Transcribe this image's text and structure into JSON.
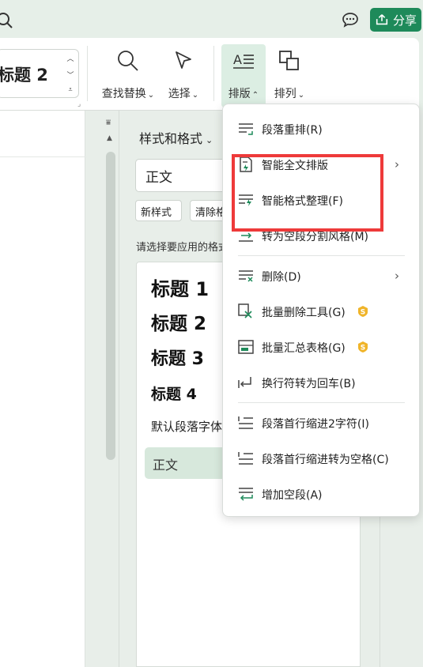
{
  "topbar": {
    "share_label": "分享"
  },
  "ribbon": {
    "style_box_text": "标题 2",
    "find_replace": "查找替换",
    "select": "选择",
    "layout": "排版",
    "arrange": "排列"
  },
  "pane": {
    "title": "样式和格式",
    "current_style": "正文",
    "new_style": "新样式",
    "clear_format": "清除格式",
    "hint": "请选择要应用的格式",
    "styles": [
      {
        "label": "标题 1"
      },
      {
        "label": "标题 2"
      },
      {
        "label": "标题 3"
      },
      {
        "label": "标题 4"
      }
    ],
    "default_para": "默认段落字体",
    "zhengwen": "正文"
  },
  "menu": {
    "items": [
      {
        "label": "段落重排(R)"
      },
      {
        "label": "智能全文排版"
      },
      {
        "label": "智能格式整理(F)"
      },
      {
        "label": "转为空段分割风格(M)"
      },
      {
        "label": "删除(D)"
      },
      {
        "label": "批量删除工具(G)"
      },
      {
        "label": "批量汇总表格(G)"
      },
      {
        "label": "换行符转为回车(B)"
      },
      {
        "label": "段落首行缩进2字符(I)"
      },
      {
        "label": "段落首行缩进转为空格(C)"
      },
      {
        "label": "增加空段(A)"
      }
    ]
  },
  "colors": {
    "accent": "#1e8a5a",
    "highlight": "#ee3a3a",
    "premium": "#f0b429"
  }
}
